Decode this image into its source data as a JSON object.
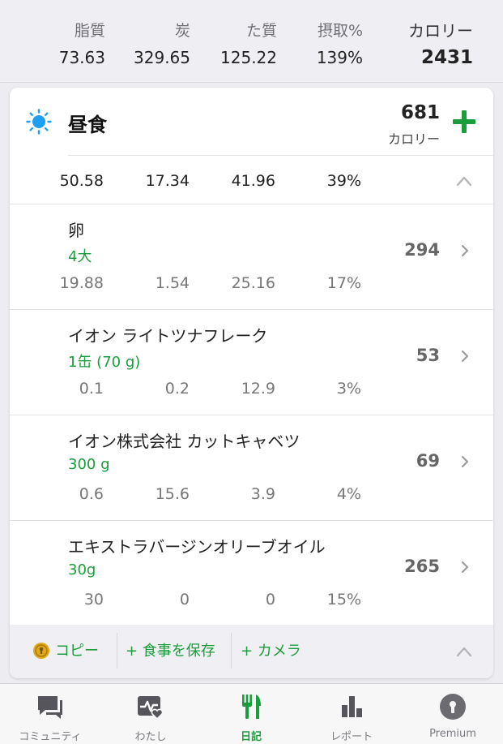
{
  "summary": {
    "columns": [
      {
        "label": "脂質",
        "value": "73.63"
      },
      {
        "label": "炭",
        "value": "329.65"
      },
      {
        "label": "た質",
        "value": "125.22"
      },
      {
        "label": "摂取%",
        "value": "139%"
      },
      {
        "label": "カロリー",
        "value": "2431"
      }
    ]
  },
  "meal": {
    "title": "昼食",
    "calories": "681",
    "calories_unit": "カロリー",
    "totals": [
      "50.58",
      "17.34",
      "41.96",
      "39%"
    ],
    "items": [
      {
        "name": "卵",
        "serving": "4大",
        "calories": "294",
        "nutrients": [
          "19.88",
          "1.54",
          "25.16",
          "17%"
        ]
      },
      {
        "name": "イオン ライトツナフレーク",
        "serving": "1缶 (70 g)",
        "calories": "53",
        "nutrients": [
          "0.1",
          "0.2",
          "12.9",
          "3%"
        ]
      },
      {
        "name": "イオン株式会社 カットキャベツ",
        "serving": "300 g",
        "calories": "69",
        "nutrients": [
          "0.6",
          "15.6",
          "3.9",
          "4%"
        ]
      },
      {
        "name": "エキストラバージンオリーブオイル",
        "serving": "30g",
        "calories": "265",
        "nutrients": [
          "30",
          "0",
          "0",
          "15%"
        ]
      }
    ],
    "actions": {
      "copy": "コピー",
      "save_meal": "+ 食事を保存",
      "camera": "+ カメラ"
    }
  },
  "tabs": [
    {
      "label": "コミュニティ",
      "icon": "chat-icon"
    },
    {
      "label": "わたし",
      "icon": "heart-monitor-icon"
    },
    {
      "label": "日記",
      "icon": "fork-knife-icon",
      "active": true
    },
    {
      "label": "レポート",
      "icon": "bar-chart-icon"
    },
    {
      "label": "Premium",
      "icon": "premium-keyhole-icon"
    }
  ],
  "colors": {
    "accent_green": "#1a9e3b",
    "sun_blue": "#1ea0f0",
    "premium_gold": "#e0a81a"
  }
}
